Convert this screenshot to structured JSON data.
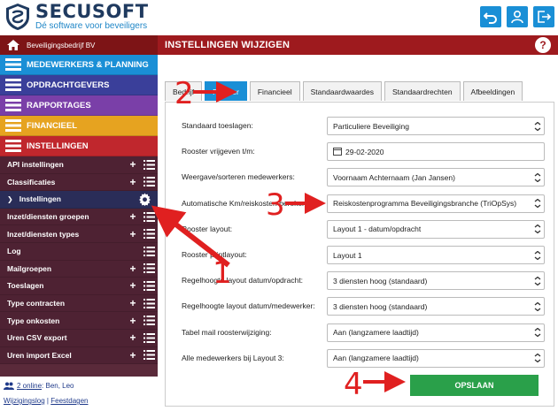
{
  "brand": {
    "name": "SECUSOFT",
    "tagline": "Dé software voor beveiligers"
  },
  "top_buttons": [
    "undo-icon",
    "user-icon",
    "logout-icon"
  ],
  "company": {
    "name": "Beveiligingsbedrijf BV"
  },
  "page_title": "INSTELLINGEN WIJZIGEN",
  "help_label": "?",
  "menu": [
    {
      "label": "MEDEWERKERS & PLANNING",
      "color": "#1a8fd6"
    },
    {
      "label": "OPDRACHTGEVERS",
      "color": "#3a3f9a"
    },
    {
      "label": "RAPPORTAGES",
      "color": "#7a3fa8"
    },
    {
      "label": "FINANCIEEL",
      "color": "#e6a320"
    },
    {
      "label": "INSTELLINGEN",
      "color": "#c0272d"
    }
  ],
  "submenu": [
    {
      "label": "API instellingen",
      "plus": true
    },
    {
      "label": "Classificaties",
      "plus": true
    },
    {
      "label": "Instellingen",
      "active": true
    },
    {
      "label": "Inzet/diensten groepen",
      "plus": true
    },
    {
      "label": "Inzet/diensten types",
      "plus": true
    },
    {
      "label": "Log",
      "plus": false
    },
    {
      "label": "Mailgroepen",
      "plus": true
    },
    {
      "label": "Toeslagen",
      "plus": true
    },
    {
      "label": "Type contracten",
      "plus": true
    },
    {
      "label": "Type onkosten",
      "plus": true
    },
    {
      "label": "Uren CSV export",
      "plus": true
    },
    {
      "label": "Uren import Excel",
      "plus": true
    }
  ],
  "footer": {
    "online": "2 online",
    "online_users": ": Ben, Leo",
    "log_link": "Wijzigingslog",
    "separator": "|",
    "holidays_link": "Feestdagen"
  },
  "tabs": [
    {
      "label": "Bedrijf"
    },
    {
      "label": "Rooster",
      "active": true
    },
    {
      "label": "Financieel"
    },
    {
      "label": "Standaardwaardes"
    },
    {
      "label": "Standaardrechten"
    },
    {
      "label": "Afbeeldingen"
    }
  ],
  "settings": [
    {
      "label": "Standaard toeslagen:",
      "value": "Particuliere Beveiliging",
      "type": "select"
    },
    {
      "label": "Rooster vrijgeven t/m:",
      "value": "29-02-2020",
      "type": "date"
    },
    {
      "label": "Weergave/sorteren medewerkers:",
      "value": "Voornaam Achternaam (Jan Jansen)",
      "type": "select"
    },
    {
      "label": "Automatische Km/reiskosten berekening:",
      "value": "Reiskostenprogramma Beveiligingsbranche (TriOpSys)",
      "type": "select"
    },
    {
      "label": "Rooster layout:",
      "value": "Layout 1 - datum/opdracht",
      "type": "select"
    },
    {
      "label": "Rooster printlayout:",
      "value": "Layout 1",
      "type": "select"
    },
    {
      "label": "Regelhoogte layout datum/opdracht:",
      "value": "3 diensten hoog (standaard)",
      "type": "select"
    },
    {
      "label": "Regelhoogte layout datum/medewerker:",
      "value": "3 diensten hoog (standaard)",
      "type": "select"
    },
    {
      "label": "Tabel mail roosterwijziging:",
      "value": "Aan (langzamere laadtijd)",
      "type": "select"
    },
    {
      "label": "Alle medewerkers bij Layout 3:",
      "value": "Aan (langzamere laadtijd)",
      "type": "select"
    }
  ],
  "save_label": "OPSLAAN",
  "annotations": [
    "1",
    "2",
    "3",
    "4"
  ],
  "colors": {
    "accent": "#1a8fd6",
    "header_red": "#9e1a1e",
    "sidebar": "#5a2a3a",
    "save": "#2aa04a",
    "annotation": "#e02020"
  }
}
